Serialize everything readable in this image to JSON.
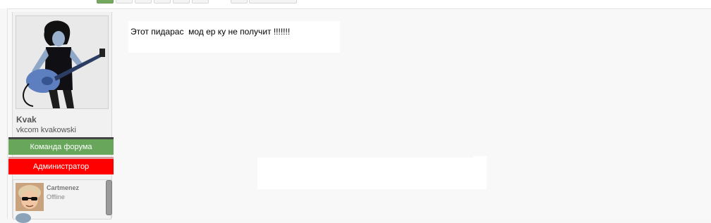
{
  "pagination": {
    "pages": [
      "",
      "",
      "",
      "",
      "",
      "",
      "",
      ""
    ]
  },
  "post": {
    "author": {
      "username": "Kvak",
      "title": "vkcom kvakowski",
      "badges": [
        {
          "label": "Команда форума",
          "color": "#68a75b"
        },
        {
          "label": "Администратор",
          "color": "#ff0000"
        }
      ]
    },
    "message": "Этот пидарас  мод ер ку не получит !!!!!!!"
  },
  "viewer": {
    "name": "Cartmenez",
    "status": "Offline"
  },
  "colors": {
    "accent_green": "#68a75b",
    "admin_red": "#ff0000"
  }
}
